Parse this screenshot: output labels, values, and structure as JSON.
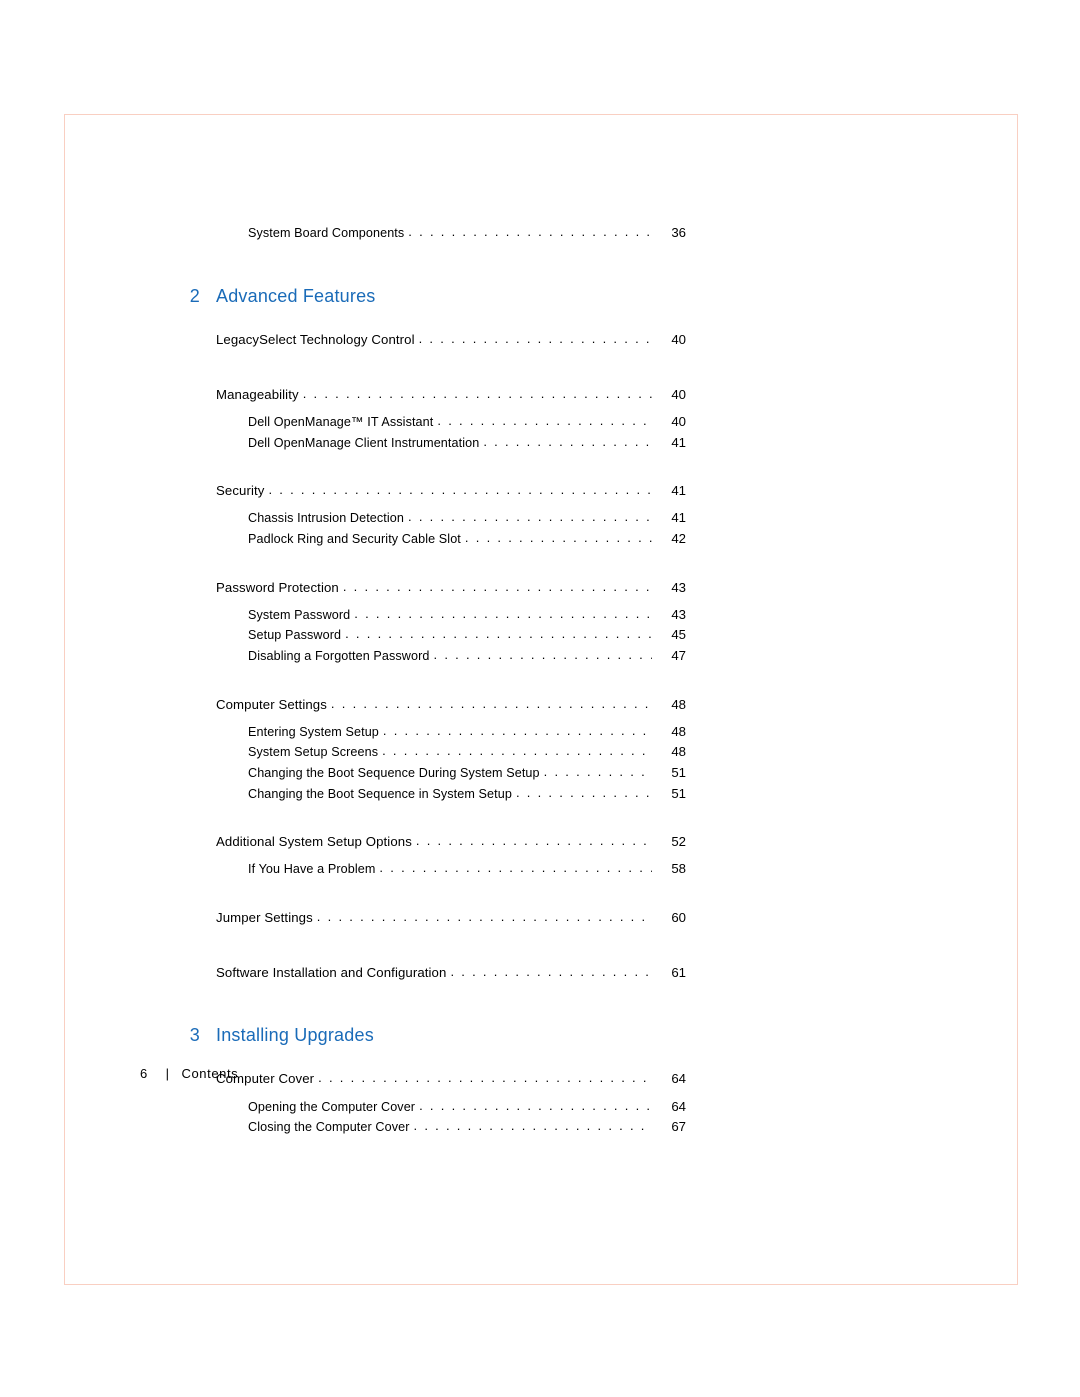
{
  "preSection": {
    "items": [
      {
        "label": "System Board Components",
        "page": "36",
        "level": 2
      }
    ]
  },
  "sections": [
    {
      "num": "2",
      "title": "Advanced Features",
      "groups": [
        [
          {
            "label": "LegacySelect Technology Control",
            "page": "40",
            "level": 1
          }
        ],
        [
          {
            "label": "Manageability",
            "page": "40",
            "level": 1
          },
          {
            "label": "Dell OpenManage™ IT Assistant",
            "page": "40",
            "level": 2
          },
          {
            "label": "Dell OpenManage Client Instrumentation",
            "page": "41",
            "level": 2
          }
        ],
        [
          {
            "label": "Security",
            "page": "41",
            "level": 1
          },
          {
            "label": "Chassis Intrusion Detection",
            "page": "41",
            "level": 2
          },
          {
            "label": "Padlock Ring and Security Cable Slot",
            "page": "42",
            "level": 2
          }
        ],
        [
          {
            "label": "Password Protection",
            "page": "43",
            "level": 1
          },
          {
            "label": "System Password",
            "page": "43",
            "level": 2
          },
          {
            "label": "Setup Password",
            "page": "45",
            "level": 2
          },
          {
            "label": "Disabling a Forgotten Password",
            "page": "47",
            "level": 2
          }
        ],
        [
          {
            "label": "Computer Settings",
            "page": "48",
            "level": 1
          },
          {
            "label": "Entering System Setup",
            "page": "48",
            "level": 2
          },
          {
            "label": "System Setup Screens",
            "page": "48",
            "level": 2
          },
          {
            "label": "Changing the Boot Sequence During System Setup",
            "page": "51",
            "level": 2
          },
          {
            "label": "Changing the Boot Sequence in System Setup",
            "page": "51",
            "level": 2
          }
        ],
        [
          {
            "label": "Additional System Setup Options",
            "page": "52",
            "level": 1
          },
          {
            "label": "If You Have a Problem",
            "page": "58",
            "level": 2
          }
        ],
        [
          {
            "label": "Jumper Settings",
            "page": "60",
            "level": 1
          }
        ],
        [
          {
            "label": "Software Installation and Configuration",
            "page": "61",
            "level": 1
          }
        ]
      ]
    },
    {
      "num": "3",
      "title": "Installing Upgrades",
      "groups": [
        [
          {
            "label": "Computer Cover",
            "page": "64",
            "level": 1
          },
          {
            "label": "Opening the Computer Cover",
            "page": "64",
            "level": 2
          },
          {
            "label": "Closing the Computer Cover",
            "page": "67",
            "level": 2
          }
        ]
      ]
    }
  ],
  "footer": {
    "pageNumber": "6",
    "separator": "|",
    "label": "Contents"
  }
}
